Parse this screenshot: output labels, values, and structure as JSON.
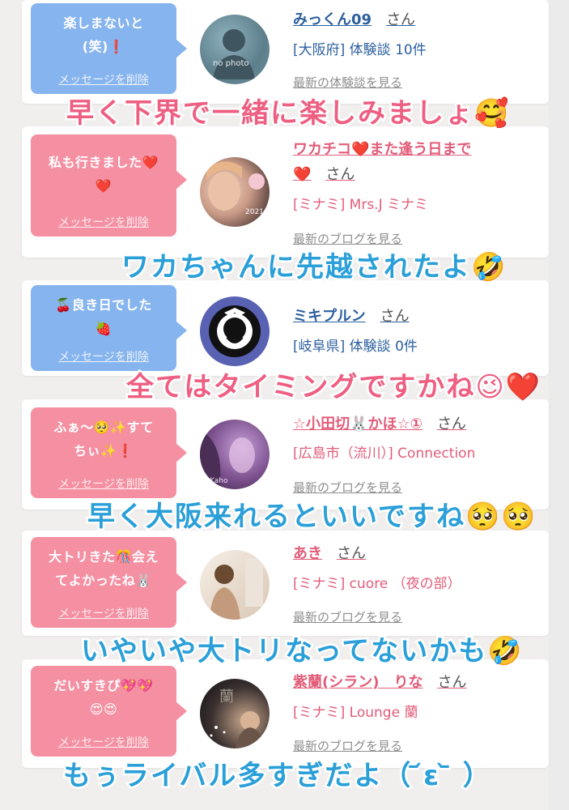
{
  "colors": {
    "blue_bubble": "#86b4ee",
    "pink_bubble": "#f58fa2",
    "blue_text": "#2b5f9e",
    "pink_text": "#e25c79"
  },
  "cards": [
    {
      "message_line1": "楽しまないと",
      "message_line2": "(笑)❗",
      "delete_label": "メッセージを削除",
      "avatar_text": "no photo",
      "name": "みっくん09",
      "suffix": "さん",
      "info": "[大阪府] 体験談 10件",
      "link": "最新の体験談を見る",
      "caption": "早く下界で一緒に楽しみましょ🥰"
    },
    {
      "message_line1": "私も行きました❤️",
      "message_line2": "❤️",
      "delete_label": "メッセージを削除",
      "name_line1": "ワカチコ❤️また逢う日まで",
      "name_line2": "❤️",
      "suffix": "さん",
      "info": "[ミナミ] Mrs.J ミナミ",
      "link": "最新のブログを見る",
      "caption": "ワカちゃんに先越されたよ🤣"
    },
    {
      "message_line1": "🍒良き日でした",
      "message_line2": "🍓",
      "delete_label": "メッセージを削除",
      "name": "ミキプルン",
      "suffix": "さん",
      "info": "[岐阜県] 体験談 0件",
      "caption": "全てはタイミングですかね😉❤️"
    },
    {
      "message_line1": "ふぁ〜🥺✨すて",
      "message_line2": "ちぃ✨❗",
      "delete_label": "メッセージを削除",
      "name": "☆小田切🐰かほ☆①",
      "suffix": "さん",
      "info": "[広島市（流川）] Connection",
      "link": "最新のブログを見る",
      "caption": "早く大阪来れるといいですね🥺🥺"
    },
    {
      "message_line1": "大トリきた🎊会え",
      "message_line2": "てよかったね🐰",
      "delete_label": "メッセージを削除",
      "name": "あき",
      "suffix": "さん",
      "info": "[ミナミ] cuore （夜の部）",
      "link": "最新のブログを見る",
      "caption": "いやいや大トリなってないかも🤣"
    },
    {
      "message_line1": "だいすきぴ💖💖",
      "message_line2": "😍😍",
      "delete_label": "メッセージを削除",
      "name": "紫蘭(シラン)　りな",
      "suffix": "さん",
      "info": "[ミナミ] Lounge 蘭",
      "link": "最新のブログを見る",
      "caption": "もぅライバル多すぎだよ（ ᷄ɛ ᷅ ）"
    }
  ]
}
